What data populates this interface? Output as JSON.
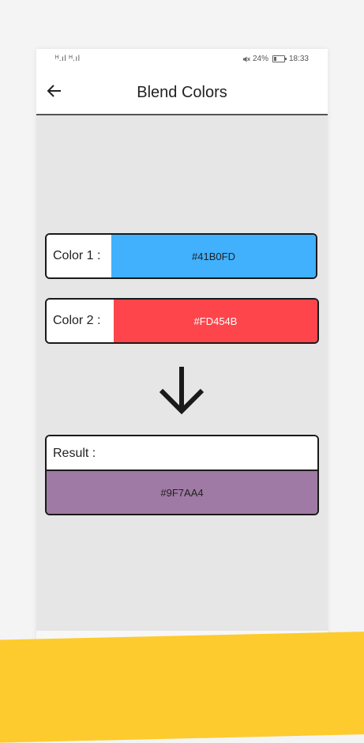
{
  "status_bar": {
    "left": "ᴴ.ıl ᴴ.ıl",
    "battery_text": "24%",
    "time": "18:33"
  },
  "app_bar": {
    "title": "Blend Colors"
  },
  "color1": {
    "label": "Color 1 :",
    "hex": "#41B0FD",
    "color": "#41B0FD"
  },
  "color2": {
    "label": "Color 2 :",
    "hex": "#FD454B",
    "color": "#FD454B"
  },
  "result": {
    "label": "Result :",
    "hex": "#9F7AA4",
    "color": "#9F7AA4"
  },
  "icons": {
    "back": "arrow-left-icon",
    "blend": "arrow-down-icon"
  },
  "accent": "#fdcb2e"
}
